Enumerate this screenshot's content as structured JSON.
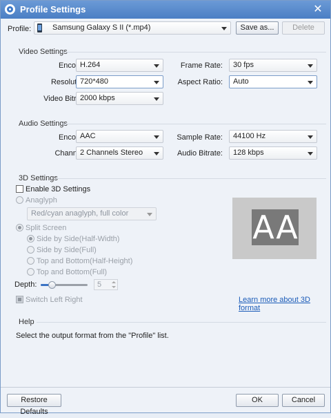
{
  "window": {
    "title": "Profile Settings"
  },
  "profile": {
    "label": "Profile:",
    "value": "Samsung Galaxy S II (*.mp4)",
    "save_as": "Save as...",
    "delete": "Delete"
  },
  "video": {
    "title": "Video Settings",
    "encoder_label": "Encoder:",
    "encoder": "H.264",
    "frame_rate_label": "Frame Rate:",
    "frame_rate": "30 fps",
    "resolution_label": "Resolution:",
    "resolution": "720*480",
    "aspect_ratio_label": "Aspect Ratio:",
    "aspect_ratio": "Auto",
    "bitrate_label": "Video Bitrate:",
    "bitrate": "2000 kbps"
  },
  "audio": {
    "title": "Audio Settings",
    "encoder_label": "Encoder:",
    "encoder": "AAC",
    "sample_rate_label": "Sample Rate:",
    "sample_rate": "44100 Hz",
    "channels_label": "Channels:",
    "channels": "2 Channels Stereo",
    "bitrate_label": "Audio Bitrate:",
    "bitrate": "128 kbps"
  },
  "three_d": {
    "title": "3D Settings",
    "enable_label": "Enable 3D Settings",
    "anaglyph_label": "Anaglyph",
    "anaglyph_value": "Red/cyan anaglyph, full color",
    "split_label": "Split Screen",
    "options": [
      "Side by Side(Half-Width)",
      "Side by Side(Full)",
      "Top and Bottom(Half-Height)",
      "Top and Bottom(Full)"
    ],
    "depth_label": "Depth:",
    "depth_value": "5",
    "depth_level": 0.25,
    "switch_label": "Switch Left Right",
    "learn_more": "Learn more about 3D format",
    "preview_letters": [
      "A",
      "A"
    ]
  },
  "help": {
    "title": "Help",
    "text": "Select the output format from the \"Profile\" list."
  },
  "footer": {
    "restore": "Restore Defaults",
    "ok": "OK",
    "cancel": "Cancel"
  },
  "colors": {
    "titlebar": "#4a7ec4",
    "link": "#1a5bb8",
    "preview_bg": "#c9c9c9",
    "preview_tile": "#797979"
  },
  "icons": {
    "app": "app-logo-icon",
    "close": "close-icon",
    "device": "phone-icon"
  }
}
